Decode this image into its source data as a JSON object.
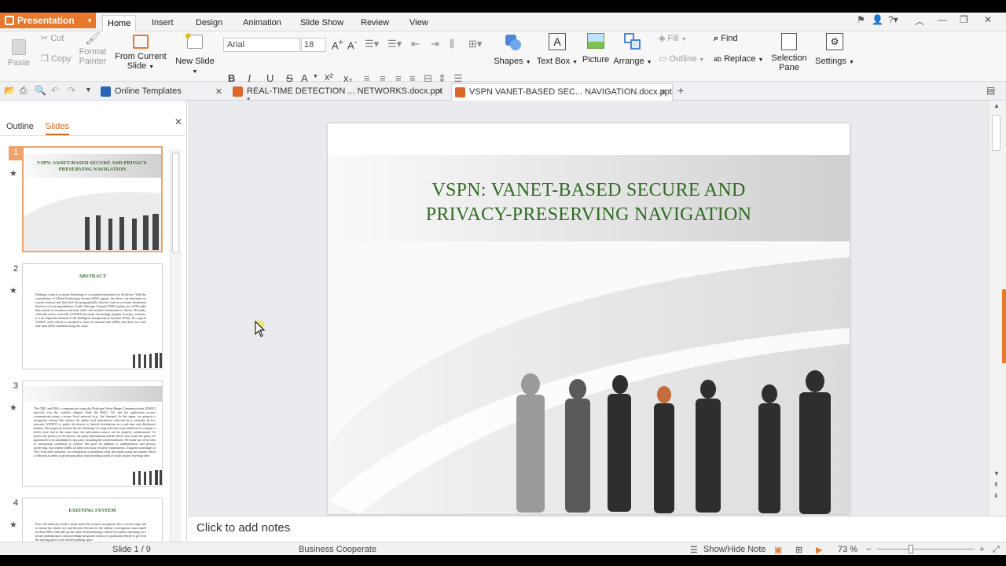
{
  "app": {
    "name": "Presentation",
    "accent": "#e8792c"
  },
  "menu": {
    "tabs": [
      "Home",
      "Insert",
      "Design",
      "Animation",
      "Slide Show",
      "Review",
      "View"
    ],
    "active": "Home"
  },
  "ribbon": {
    "paste": "Paste",
    "cut": "Cut",
    "copy": "Copy",
    "format_painter_1": "Format",
    "format_painter_2": "Painter",
    "from_current_1": "From Current",
    "from_current_2": "Slide",
    "new_slide": "New Slide",
    "font_name": "Arial",
    "font_size": "18",
    "shapes": "Shapes",
    "text_box": "Text Box",
    "picture": "Picture",
    "arrange": "Arrange",
    "fill": "Fill",
    "outline": "Outline",
    "find": "Find",
    "replace": "Replace",
    "selection_pane_1": "Selection",
    "selection_pane_2": "Pane",
    "settings": "Settings"
  },
  "doc_tabs": [
    {
      "label": "Online Templates"
    },
    {
      "label": "REAL-TIME DETECTION ... NETWORKS.docx.ppt *"
    },
    {
      "label": "VSPN VANET-BASED SEC... NAVIGATION.docx.ppt"
    }
  ],
  "panel": {
    "tab_outline": "Outline",
    "tab_slides": "Slides"
  },
  "thumbs": [
    {
      "num": "1",
      "title": "VSPN: VANET-BASED SECURE AND PRIVACY-PRESERVING NAVIGATION"
    },
    {
      "num": "2",
      "title": "ABSTRACT",
      "text": "Finding a route to a certain destination is a common experience for all drivers. With the convenience of Global Positioning System (GPS) signals, the driver can determine its current location and then find the geographically shortest route to a certain destination based on a local map database. Traffic Message Channel (TMC) makes use of FM radio data system to broadcast real-time traffic and weather information to drivers. Recently, vehicular ad hoc networks (VANET) becomes increasingly popular in many countries. It is an important element of the Intelligent Transportation Systems (ITSs). In a typical VANET, each vehicle is assumed to have an onboard unit (OBU) and there are road-side units (RSU) installed along the roads."
    },
    {
      "num": "3",
      "title": "",
      "text": "The OBU and RSUs communicate using the Dedicated Short-Range Communications (DSRC) protocol over the wireless channel while the RSUs, TA, and the application servers communicate using a secure fixed network (e.g., the Internet). In this paper, we propose a navigation scheme that utilizes the online road information collected by a vehicular ad hoc network (VANET) to guide the drivers to desired destinations in a real-time and distributed manner. The proposed scheme has the advantage of using real-time road conditions to compute a better route and at the same time, the information source can be properly authenticated. To protect the privacy of the drivers, the query (destination) and the driver who issues the query are guaranteed to be unlinkable to any party including the trusted authority. We make use of the idea of anonymous credential to achieve this goal. In addition to authentication and privacy preserving, our scheme fulfills all other necessary security requirements. Using the road maps of New York and California, we evaluated in a simulation study the results using our scheme which is efficient in terms of processing delay and providing routes of much shorter traveling time."
    },
    {
      "num": "4",
      "title": "EXISTING SYSTEM",
      "text": "First, the authority needs a small under the scenario navigation, this is easier, large and to ensure the whole city and beyond. Second, in the scheme a navigation route issued by these RSUs that take up the value of determining a vehicle's location, searching for a secure parking space, and providing navigation routes to a particular vehicle to go from the starting place to the desired parking space."
    }
  ],
  "slide": {
    "title_line1": "VSPN: VANET-BASED SECURE AND",
    "title_line2": "PRIVACY-PRESERVING NAVIGATION",
    "title_color": "#2f6b23"
  },
  "notes_placeholder": "Click to add notes",
  "status": {
    "slide": "Slide 1 / 9",
    "theme": "Business Cooperate",
    "show_hide_note": "Show/Hide Note",
    "zoom": "73 %"
  }
}
